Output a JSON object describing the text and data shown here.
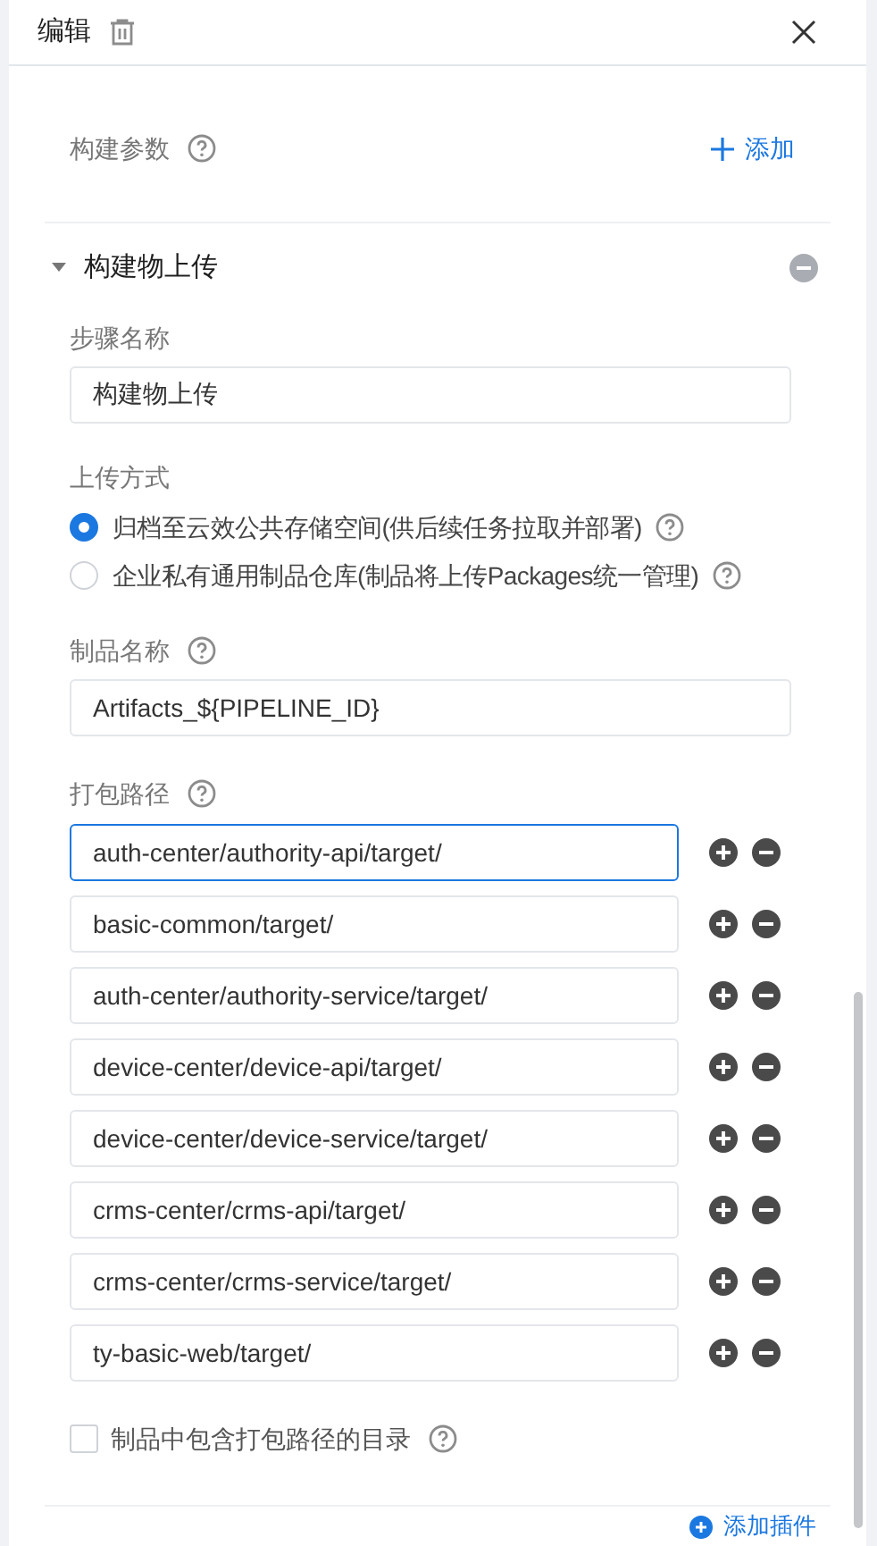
{
  "header": {
    "title": "编辑"
  },
  "build_params": {
    "label": "构建参数",
    "add_link": "添加"
  },
  "section": {
    "title": "构建物上传",
    "expanded": true
  },
  "step_name": {
    "label": "步骤名称",
    "value": "构建物上传"
  },
  "upload_mode": {
    "label": "上传方式",
    "options": [
      {
        "label": "归档至云效公共存储空间(供后续任务拉取并部署)",
        "selected": true
      },
      {
        "label": "企业私有通用制品仓库(制品将上传Packages统一管理)",
        "selected": false
      }
    ]
  },
  "artifact_name": {
    "label": "制品名称",
    "value": "Artifacts_${PIPELINE_ID}"
  },
  "package_paths": {
    "label": "打包路径",
    "paths": [
      {
        "value": "auth-center/authority-api/target/",
        "focused": true
      },
      {
        "value": "basic-common/target/",
        "focused": false
      },
      {
        "value": "auth-center/authority-service/target/",
        "focused": false
      },
      {
        "value": "device-center/device-api/target/",
        "focused": false
      },
      {
        "value": "device-center/device-service/target/",
        "focused": false
      },
      {
        "value": "crms-center/crms-api/target/",
        "focused": false
      },
      {
        "value": "crms-center/crms-service/target/",
        "focused": false
      },
      {
        "value": "ty-basic-web/target/",
        "focused": false
      }
    ]
  },
  "include_dir": {
    "label": "制品中包含打包路径的目录",
    "checked": false
  },
  "add_plugin": "添加插件"
}
